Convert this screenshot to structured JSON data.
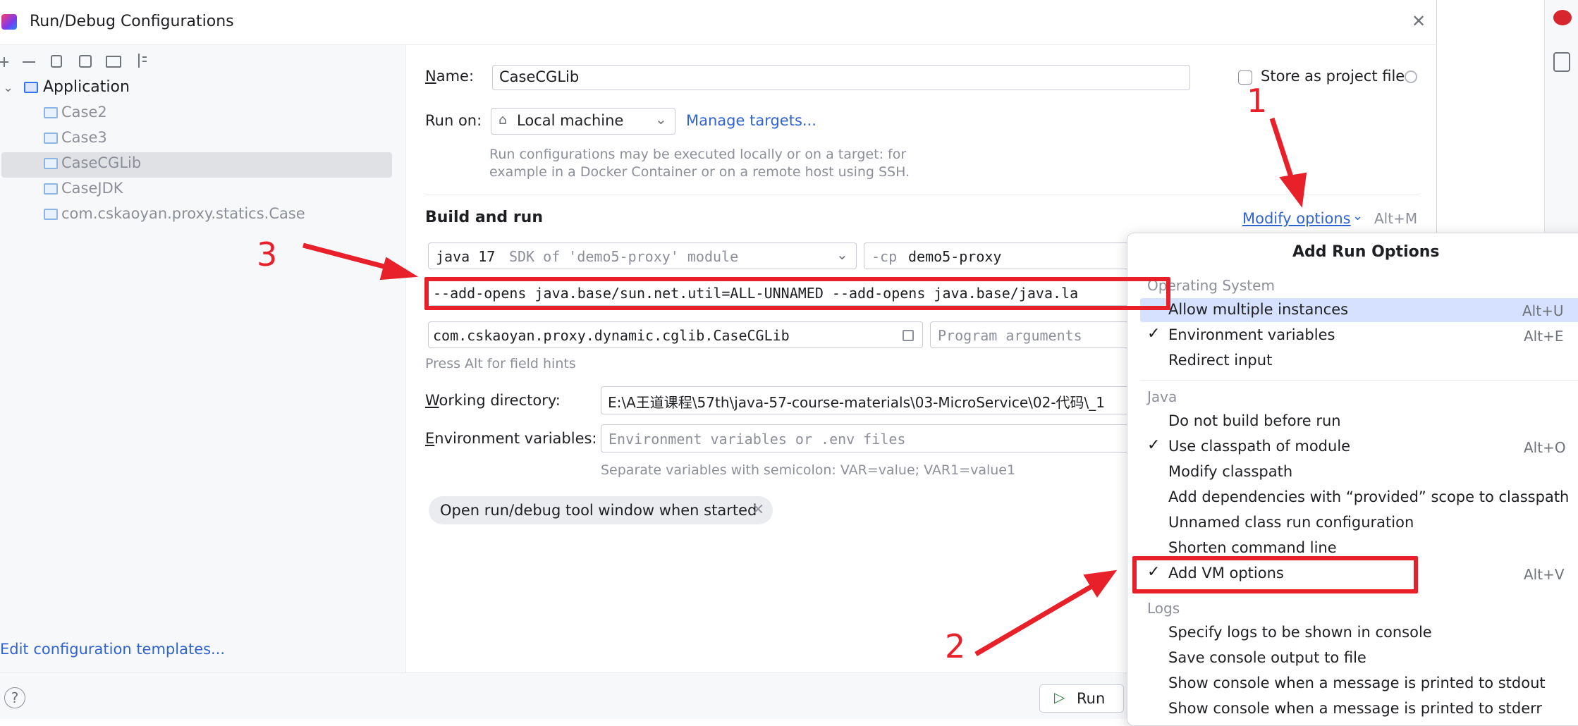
{
  "window": {
    "title": "Run/Debug Configurations",
    "close_glyph": "✕"
  },
  "toolbar": {
    "icons": [
      "add-icon",
      "remove-icon",
      "copy-icon",
      "save-icon",
      "new-folder-icon",
      "sort-icon"
    ]
  },
  "tree": {
    "root_label": "Application",
    "items": [
      {
        "label": "Case2"
      },
      {
        "label": "Case3"
      },
      {
        "label": "CaseCGLib"
      },
      {
        "label": "CaseJDK"
      },
      {
        "label": "com.cskaoyan.proxy.statics.Case"
      }
    ],
    "selected": "CaseCGLib"
  },
  "edit_templates_link": "Edit configuration templates...",
  "form": {
    "name_label_mnemonic": "N",
    "name_label_rest": "ame:",
    "name_value": "CaseCGLib",
    "store_label": "Store as project file",
    "run_on_label": "Run on:",
    "run_on_value": "Local machine",
    "manage_targets": "Manage targets...",
    "run_on_hint_line1": "Run configurations may be executed locally or on a target: for",
    "run_on_hint_line2": "example in a Docker Container or on a remote host using SSH.",
    "build_and_run": "Build and run",
    "modify_options": "Modify options",
    "modify_options_shortcut": "Alt+M",
    "jdk_version": "java 17",
    "jdk_detail": "SDK of 'demo5-proxy' module",
    "cp_flag": "-cp",
    "cp_value": "demo5-proxy",
    "vm_options": "--add-opens java.base/sun.net.util=ALL-UNNAMED --add-opens java.base/java.la",
    "main_class": "com.cskaoyan.proxy.dynamic.cglib.CaseCGLib",
    "program_args_placeholder": "Program arguments",
    "field_hints": "Press Alt for field hints",
    "workdir_label_mnemonic": "W",
    "workdir_label_rest": "orking directory:",
    "workdir_value": "E:\\A王道课程\\57th\\java-57-course-materials\\03-MicroService\\02-代码\\_1",
    "env_label_mnemonic": "E",
    "env_label_rest": "nvironment variables:",
    "env_placeholder": "Environment variables or .env files",
    "env_hint": "Separate variables with semicolon: VAR=value; VAR1=value1",
    "chip_label": "Open run/debug tool window when started",
    "chip_close": "×"
  },
  "popup": {
    "title": "Add Run Options",
    "sections": [
      {
        "name": "Operating System",
        "items": [
          {
            "label": "Allow multiple instances",
            "shortcut": "Alt+U",
            "checked": false,
            "highlighted": true
          },
          {
            "label": "Environment variables",
            "shortcut": "Alt+E",
            "checked": true
          },
          {
            "label": "Redirect input",
            "shortcut": "",
            "checked": false
          }
        ]
      },
      {
        "name": "Java",
        "items": [
          {
            "label": "Do not build before run",
            "shortcut": "",
            "checked": false
          },
          {
            "label": "Use classpath of module",
            "shortcut": "Alt+O",
            "checked": true
          },
          {
            "label": "Modify classpath",
            "shortcut": "",
            "checked": false
          },
          {
            "label": "Add dependencies with “provided” scope to classpath",
            "shortcut": "",
            "checked": false
          },
          {
            "label": "Unnamed class run configuration",
            "shortcut": "",
            "checked": false
          },
          {
            "label": "Shorten command line",
            "shortcut": "",
            "checked": false
          },
          {
            "label": "Add VM options",
            "shortcut": "Alt+V",
            "checked": true
          }
        ]
      },
      {
        "name": "Logs",
        "items": [
          {
            "label": "Specify logs to be shown in console",
            "shortcut": "",
            "checked": false
          },
          {
            "label": "Save console output to file",
            "shortcut": "",
            "checked": false
          },
          {
            "label": "Show console when a message is printed to stdout",
            "shortcut": "",
            "checked": false
          },
          {
            "label": "Show console when a message is printed to stderr",
            "shortcut": "",
            "checked": false
          }
        ]
      }
    ]
  },
  "bottom": {
    "help": "?",
    "run_button": "Run"
  },
  "annotations": {
    "n1": "1",
    "n2": "2",
    "n3": "3",
    "color": "#e8202a"
  },
  "colors": {
    "accent": "#3574f0",
    "link": "#2f63d4",
    "selection": "#dfe1e5",
    "popup_highlight": "#d5e1ff"
  }
}
